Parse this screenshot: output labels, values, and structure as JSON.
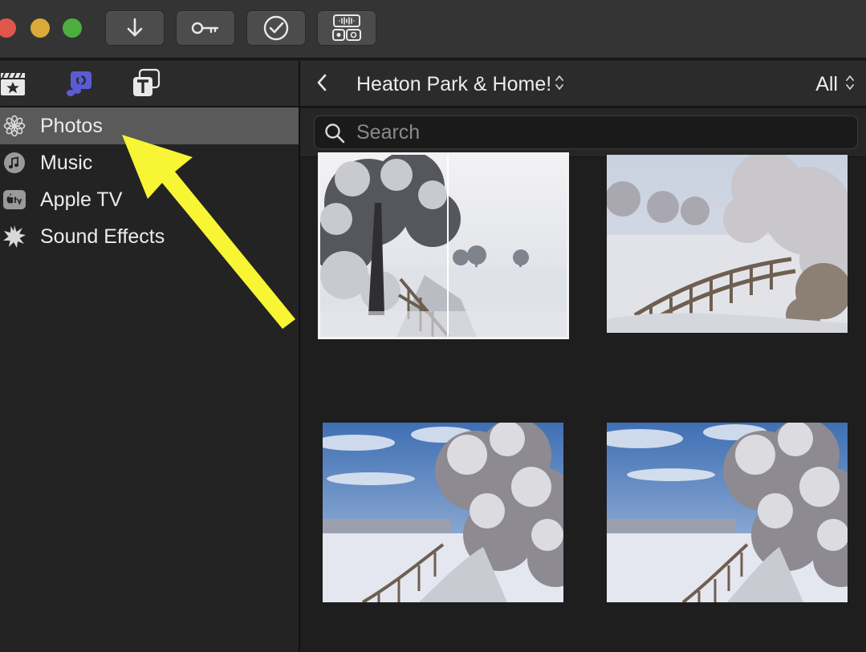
{
  "toolbar": {
    "buttons": [
      {
        "name": "import-button",
        "icon": "download-arrow-icon"
      },
      {
        "name": "keyword-button",
        "icon": "key-icon"
      },
      {
        "name": "check-button",
        "icon": "checkmark-circle-icon"
      },
      {
        "name": "audio-video-button",
        "icon": "audio-video-icon"
      }
    ]
  },
  "sidebar": {
    "tabs": [
      {
        "name": "projects-tab",
        "icon": "clapperboard-star-icon"
      },
      {
        "name": "photos-music-tab",
        "icon": "photo-music-icon",
        "active": true,
        "color": "#5b5bd6"
      },
      {
        "name": "titles-tab",
        "icon": "titles-icon"
      }
    ],
    "items": [
      {
        "label": "Photos",
        "icon": "flower-icon",
        "selected": true
      },
      {
        "label": "Music",
        "icon": "music-note-icon"
      },
      {
        "label": "Apple TV",
        "icon": "apple-tv-icon"
      },
      {
        "label": "Sound Effects",
        "icon": "burst-icon"
      }
    ]
  },
  "browser": {
    "album_title": "Heaton Park & Home!",
    "filter": "All",
    "search_placeholder": "Search"
  },
  "annotation": {
    "color": "#f8f534"
  }
}
